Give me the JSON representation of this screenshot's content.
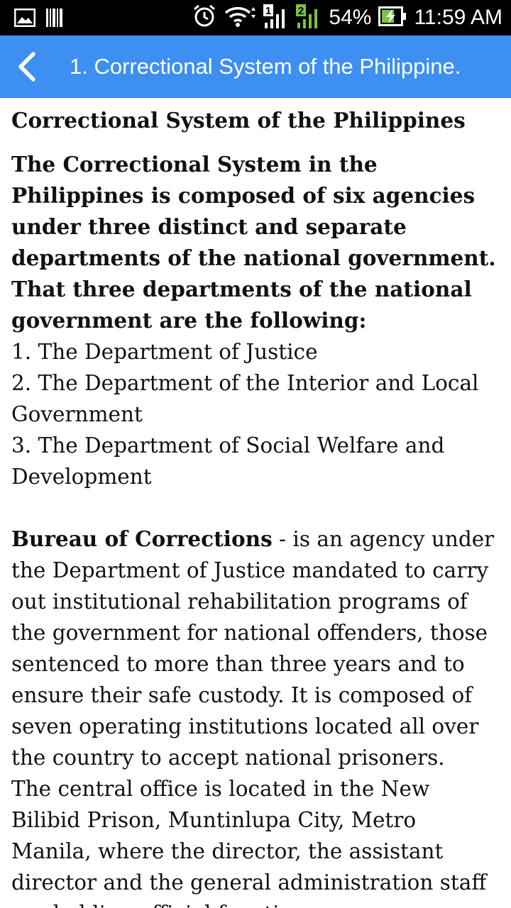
{
  "status_bar": {
    "battery": "54%",
    "time": "11:59 AM",
    "sim1": "1",
    "sim2": "2"
  },
  "app_bar": {
    "title": "1. Correctional System of the Philippine."
  },
  "article": {
    "heading": "Correctional System of the Philippines",
    "intro": "The Correctional System in the Philippines is composed of six agencies under three distinct and separate departments of the national government. That three departments of the national government are the following:",
    "departments": [
      "1. The Department of Justice",
      "2. The Department of the Interior and Local Government",
      "3. The Department of Social Welfare and Development"
    ],
    "bureau_title": "Bureau of Corrections",
    "bureau_text": " - is an agency under the Department of Justice mandated to carry out institutional rehabilitation programs of the government for national offenders, those sentenced to more than  three years and to ensure their safe custody. It is composed of seven operating institutions located all over the country to accept national prisoners.",
    "central_office_text": "The central office is located in the New Bilibid Prison, Muntinlupa City, Metro Manila, where the director, the assistant director and the general administration staff are holding official functions."
  },
  "colors": {
    "app_bar": "#3d8ff2",
    "status_bar": "#000000",
    "text": "#111111",
    "signal_green": "#7cc242"
  }
}
